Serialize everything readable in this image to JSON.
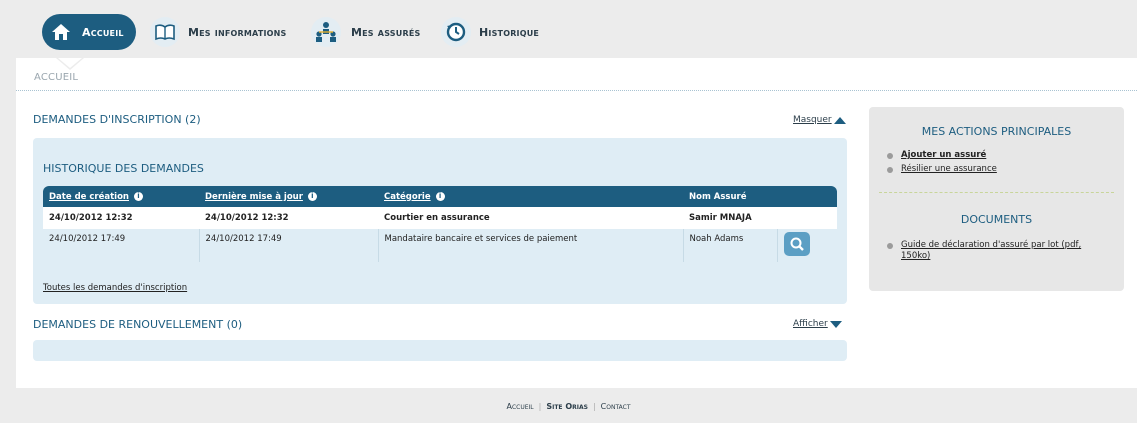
{
  "nav": {
    "items": [
      {
        "label": "Accueil",
        "icon": "home-icon",
        "active": true
      },
      {
        "label": "Mes informations",
        "icon": "book-icon",
        "active": false
      },
      {
        "label": "Mes assurés",
        "icon": "people-icon",
        "active": false
      },
      {
        "label": "Historique",
        "icon": "history-icon",
        "active": false
      }
    ]
  },
  "breadcrumb": "ACCUEIL",
  "inscription": {
    "title": "DEMANDES D'INSCRIPTION (2)",
    "toggle_label": "Masquer",
    "history_title": "HISTORIQUE DES DEMANDES",
    "columns": [
      "Date de création",
      "Dernière mise à jour",
      "Catégorie",
      "Nom Assuré",
      ""
    ],
    "rows": [
      {
        "created": "24/10/2012 12:32",
        "updated": "24/10/2012 12:32",
        "category": "Courtier en assurance",
        "name": "Samir MNAJA"
      },
      {
        "created": "24/10/2012 17:49",
        "updated": "24/10/2012 17:49",
        "category": "Mandataire bancaire et services de paiement",
        "name": "Noah Adams"
      }
    ],
    "all_link": "Toutes les demandes d'inscription"
  },
  "renouvellement": {
    "title": "DEMANDES DE RENOUVELLEMENT (0)",
    "toggle_label": "Afficher"
  },
  "sidebar": {
    "actions_title": "MES ACTIONS PRINCIPALES",
    "actions": [
      "Ajouter un assuré",
      "Résilier une assurance"
    ],
    "documents_title": "DOCUMENTS",
    "documents": [
      "Guide de déclaration d'assuré par lot (pdf,",
      "150ko)"
    ]
  },
  "footer": {
    "links": [
      "Accueil",
      "Site Orias",
      "Contact"
    ]
  },
  "colors": {
    "accent": "#1d5d80",
    "box": "#dfedf5",
    "page_bg": "#ececec"
  }
}
